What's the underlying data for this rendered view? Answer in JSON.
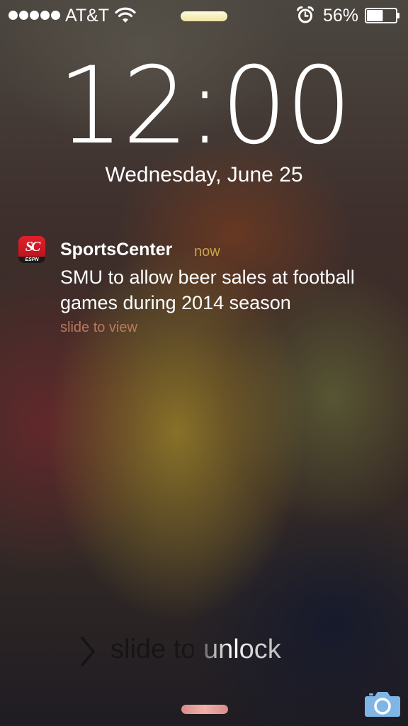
{
  "status_bar": {
    "signal_bars": 5,
    "carrier": "AT&T",
    "wifi_icon": "wifi-icon",
    "alarm_icon": "alarm-clock-icon",
    "battery_percent": "56%",
    "battery_level": 0.56
  },
  "lock_screen": {
    "time": "12:00",
    "date": "Wednesday, June 25"
  },
  "notification": {
    "app_icon": "sportscenter-app-icon",
    "app_icon_text": "SC",
    "app_icon_subtext": "ESPN",
    "app_name": "SportsCenter",
    "time": "now",
    "message": "SMU to allow beer sales at football games during 2014 season",
    "action": "slide to view",
    "time_color": "#c9a24e",
    "action_color": "#b87a5e"
  },
  "unlock": {
    "label": "slide to unlock",
    "chevron_icon": "chevron-right-icon"
  },
  "bottom": {
    "camera_icon": "camera-icon"
  }
}
